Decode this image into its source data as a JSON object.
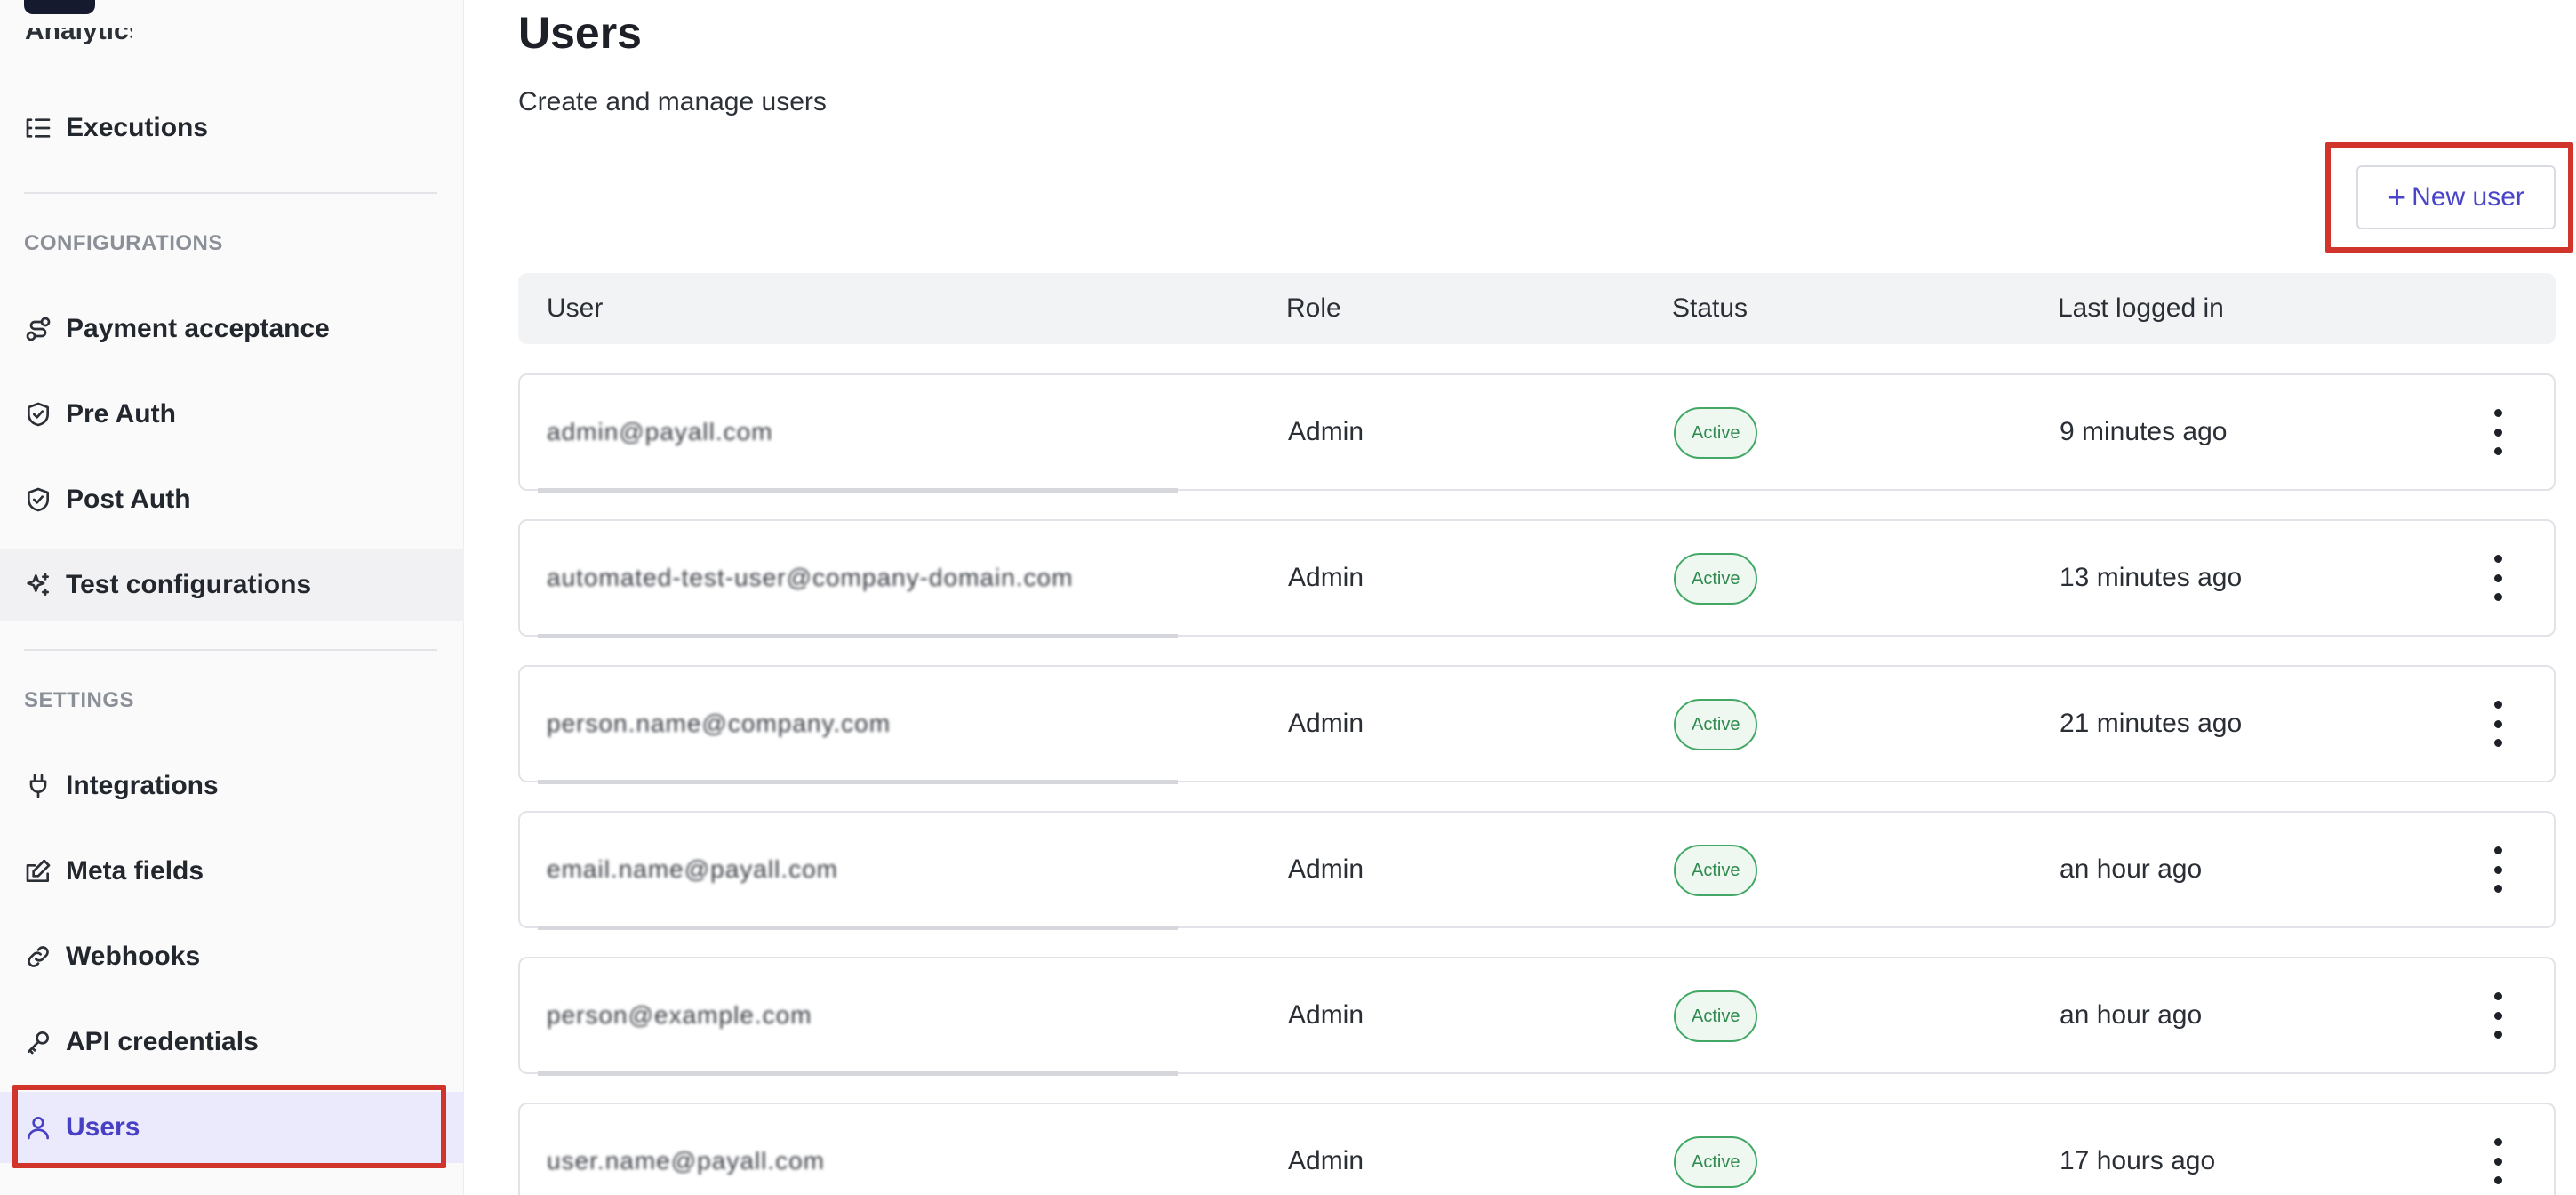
{
  "sidebar": {
    "partial_top_label": "Analytics",
    "items_top": [
      {
        "label": "Executions",
        "icon": "list-tree-icon"
      }
    ],
    "configurations_title": "CONFIGURATIONS",
    "configurations": [
      {
        "label": "Payment acceptance",
        "icon": "route-icon"
      },
      {
        "label": "Pre Auth",
        "icon": "shield-check-icon"
      },
      {
        "label": "Post Auth",
        "icon": "shield-check-icon"
      },
      {
        "label": "Test configurations",
        "icon": "sparkles-icon"
      }
    ],
    "settings_title": "SETTINGS",
    "settings": [
      {
        "label": "Integrations",
        "icon": "plug-icon"
      },
      {
        "label": "Meta fields",
        "icon": "edit-icon"
      },
      {
        "label": "Webhooks",
        "icon": "link-icon"
      },
      {
        "label": "API credentials",
        "icon": "key-icon"
      },
      {
        "label": "Users",
        "icon": "user-icon"
      }
    ],
    "active_item": "Users",
    "active_color": "#4740c4"
  },
  "main": {
    "title": "Users",
    "subtitle": "Create and manage users",
    "new_user_label": "New user",
    "new_user_icon": "+",
    "columns": [
      "User",
      "Role",
      "Status",
      "Last logged in"
    ],
    "rows": [
      {
        "email": "admin@payall.com",
        "role": "Admin",
        "status": "Active",
        "last_login": "9 minutes ago"
      },
      {
        "email": "automated-test-user@company-domain.com",
        "role": "Admin",
        "status": "Active",
        "last_login": "13 minutes ago"
      },
      {
        "email": "person.name@company.com",
        "role": "Admin",
        "status": "Active",
        "last_login": "21 minutes ago"
      },
      {
        "email": "email.name@payall.com",
        "role": "Admin",
        "status": "Active",
        "last_login": "an hour ago"
      },
      {
        "email": "person@example.com",
        "role": "Admin",
        "status": "Active",
        "last_login": "an hour ago"
      },
      {
        "email": "user.name@payall.com",
        "role": "Admin",
        "status": "Active",
        "last_login": "17 hours ago"
      }
    ]
  },
  "colors": {
    "highlight": "#d0342a",
    "status_active": "#2f8a4f",
    "accent": "#4a44c9"
  }
}
